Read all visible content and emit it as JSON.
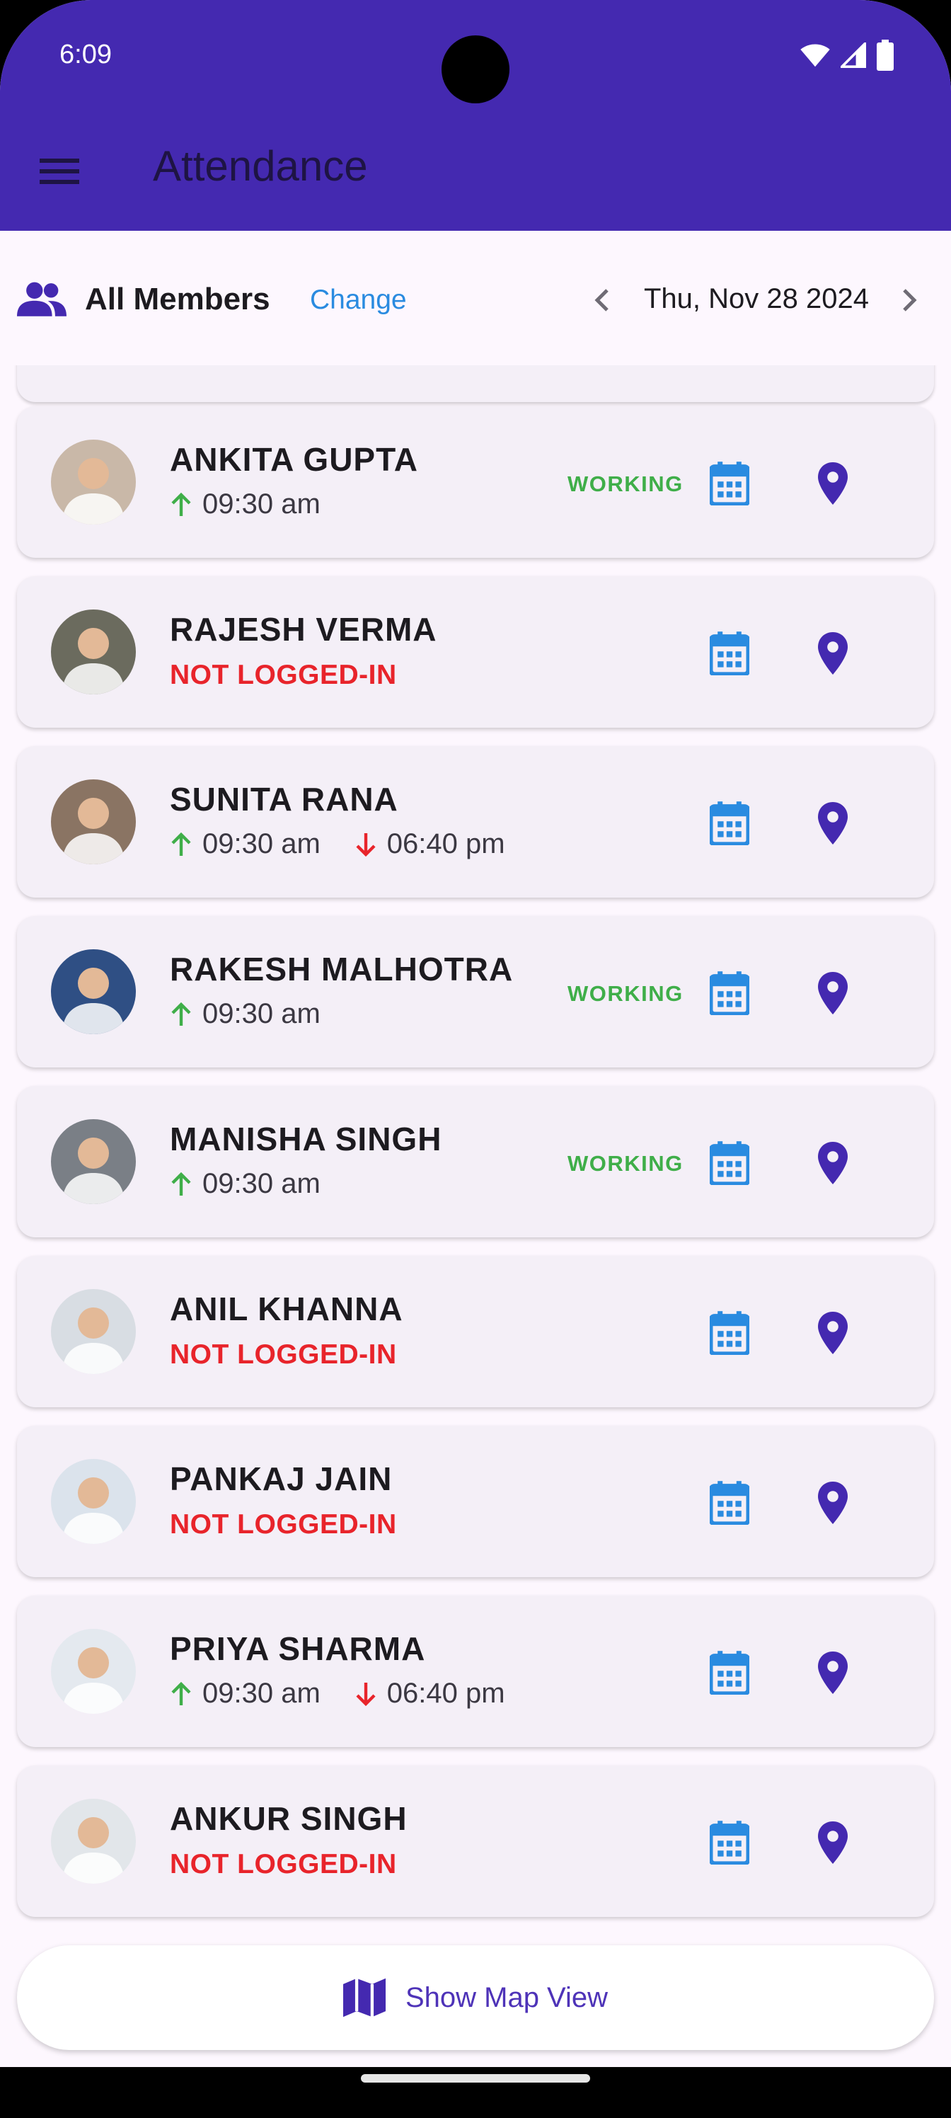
{
  "status_bar": {
    "time": "6:09"
  },
  "app_bar": {
    "title": "Attendance",
    "menu_icon": "hamburger-menu-icon"
  },
  "filter": {
    "members_label": "All Members",
    "change_label": "Change",
    "date": "Thu, Nov 28 2024"
  },
  "members": [
    {
      "name": "ANKITA GUPTA",
      "status": "WORKING",
      "in": "09:30 am",
      "out": null,
      "logged_in": true,
      "avatar_color": "#c9b8a8"
    },
    {
      "name": "RAJESH VERMA",
      "status": "",
      "not_logged": "NOT LOGGED-IN",
      "logged_in": false,
      "avatar_color": "#6b6b5e"
    },
    {
      "name": "SUNITA RANA",
      "status": "",
      "in": "09:30 am",
      "out": "06:40 pm",
      "logged_in": true,
      "avatar_color": "#8a7463"
    },
    {
      "name": "RAKESH MALHOTRA",
      "status": "WORKING",
      "in": "09:30 am",
      "out": null,
      "logged_in": true,
      "avatar_color": "#2f4f84"
    },
    {
      "name": "MANISHA SINGH",
      "status": "WORKING",
      "in": "09:30 am",
      "out": null,
      "logged_in": true,
      "avatar_color": "#7a7f86"
    },
    {
      "name": "ANIL KHANNA",
      "status": "",
      "not_logged": "NOT LOGGED-IN",
      "logged_in": false,
      "avatar_color": "#d8dde3"
    },
    {
      "name": "PANKAJ JAIN",
      "status": "",
      "not_logged": "NOT LOGGED-IN",
      "logged_in": false,
      "avatar_color": "#dbe3ec"
    },
    {
      "name": "PRIYA SHARMA",
      "status": "",
      "in": "09:30 am",
      "out": "06:40 pm",
      "logged_in": true,
      "avatar_color": "#e4e9ef"
    },
    {
      "name": "ANKUR SINGH",
      "status": "",
      "not_logged": "NOT LOGGED-IN",
      "logged_in": false,
      "avatar_color": "#e2e6ea"
    }
  ],
  "map_button": {
    "label": "Show Map View"
  },
  "colors": {
    "primary": "#4429b0",
    "working": "#3fae49",
    "not_logged": "#e8242b",
    "calendar": "#2a8be0",
    "location": "#4429b0",
    "arrow_in": "#3fae49",
    "arrow_out": "#e8242b"
  }
}
